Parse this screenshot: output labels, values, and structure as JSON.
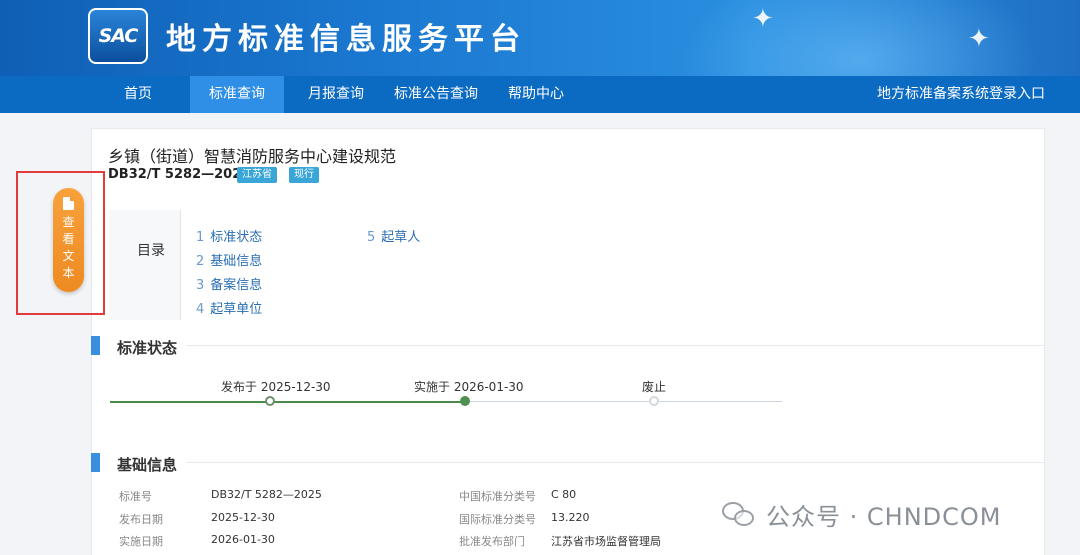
{
  "header": {
    "logo_text": "SAC",
    "site_title": "地方标准信息服务平台"
  },
  "nav": {
    "items": [
      {
        "label": "首页"
      },
      {
        "label": "标准查询"
      },
      {
        "label": "月报查询"
      },
      {
        "label": "标准公告查询"
      },
      {
        "label": "帮助中心"
      }
    ],
    "active": "标准查询",
    "right_link": "地方标准备案系统登录入口"
  },
  "standard": {
    "title": "乡镇（街道）智慧消防服务中心建设规范",
    "code": "DB32/T 5282—2025",
    "province_tag": "江苏省",
    "status_tag": "现行"
  },
  "toc": {
    "label": "目录",
    "items": [
      {
        "num": "1",
        "label": "标准状态"
      },
      {
        "num": "2",
        "label": "基础信息"
      },
      {
        "num": "3",
        "label": "备案信息"
      },
      {
        "num": "4",
        "label": "起草单位"
      },
      {
        "num": "5",
        "label": "起草人"
      }
    ]
  },
  "status_section": {
    "title": "标准状态",
    "timeline": [
      {
        "label": "发布于 2025-12-30",
        "state": "done"
      },
      {
        "label": "实施于 2026-01-30",
        "state": "current"
      },
      {
        "label": "废止",
        "state": "pending"
      }
    ]
  },
  "basic_section": {
    "title": "基础信息",
    "rows": [
      {
        "k1": "标准号",
        "v1": "DB32/T 5282—2025",
        "k2": "中国标准分类号",
        "v2": "C 80"
      },
      {
        "k1": "发布日期",
        "v1": "2025-12-30",
        "k2": "国际标准分类号",
        "v2": "13.220"
      },
      {
        "k1": "实施日期",
        "v1": "2026-01-30",
        "k2": "批准发布部门",
        "v2": "江苏省市场监督管理局"
      }
    ]
  },
  "view_text_button": {
    "label_chars": [
      "查",
      "看",
      "文",
      "本"
    ],
    "icon": "document-icon"
  },
  "watermark": {
    "text": "公众号 · CHNDCOM",
    "icon": "wechat-icon"
  },
  "colors": {
    "header_blue": "#1b78d0",
    "nav_blue": "#0b6ac1",
    "nav_active": "#2f8ee6",
    "section_accent": "#3a8ee0",
    "timeline_green": "#4b8a4b",
    "button_orange": "#f29a33",
    "annotation_red": "#e23b3b"
  }
}
